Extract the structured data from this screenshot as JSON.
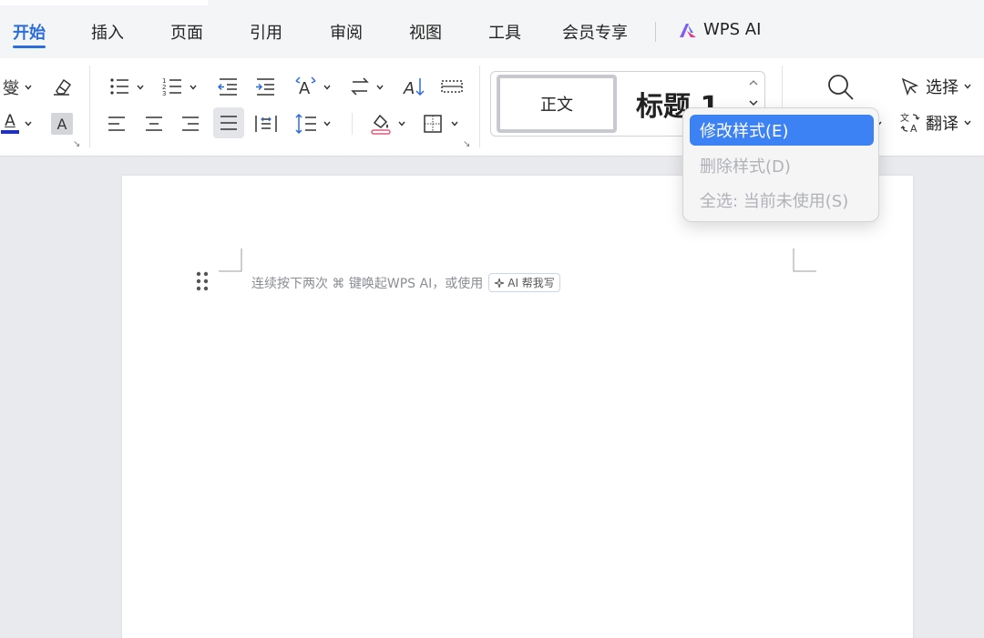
{
  "tabs": {
    "home": "开始",
    "insert": "插入",
    "page": "页面",
    "reference": "引用",
    "review": "审阅",
    "view": "视图",
    "tools": "工具",
    "member": "会员专享",
    "wps_ai": "WPS AI"
  },
  "ribbon": {
    "font_color_letter": "A",
    "char_shading_letter": "A",
    "style_normal": "正文",
    "style_heading": "标题 1",
    "select_label": "选择",
    "translate_label": "翻译",
    "corner_arrow": "↘"
  },
  "context_menu": {
    "items": [
      {
        "label": "修改样式(E)",
        "state": "highlighted"
      },
      {
        "label": "删除样式(D)",
        "state": "disabled"
      },
      {
        "label": "全选: 当前未使用(S)",
        "state": "disabled"
      }
    ]
  },
  "document": {
    "hint_text": "连续按下两次 ⌘ 键唤起WPS AI，或使用",
    "ai_chip": "AI 帮我写"
  },
  "colors": {
    "accent": "#2b6ddb",
    "menu_highlight": "#3d82f4",
    "font_color_bar": "#1a2fd6"
  }
}
